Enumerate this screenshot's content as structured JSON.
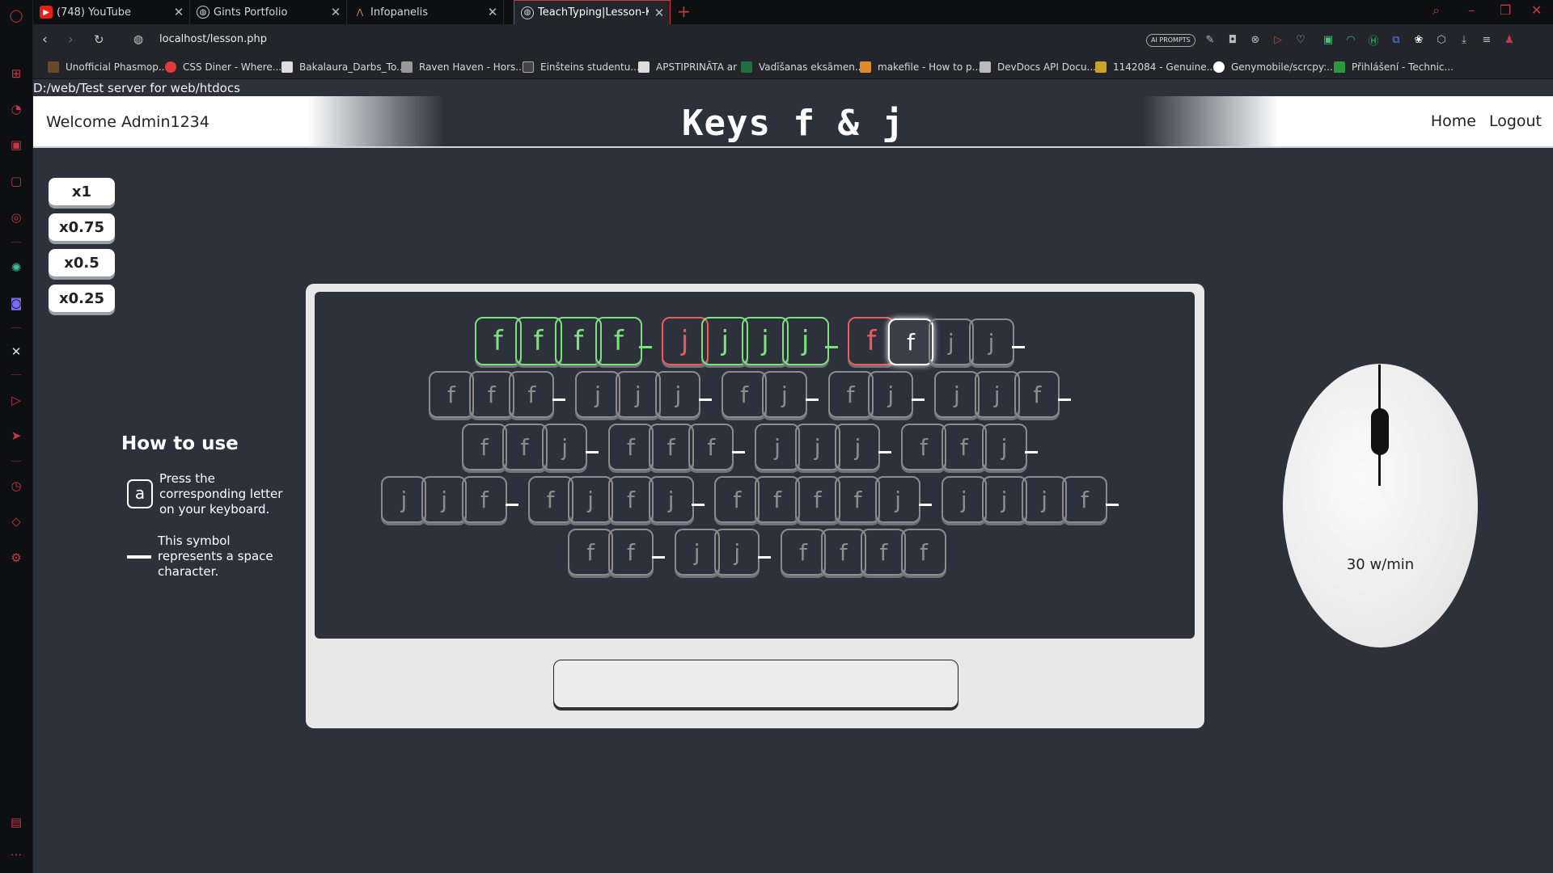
{
  "browser": {
    "tabs": [
      {
        "label": "(748) YouTube",
        "icon": "youtube-icon"
      },
      {
        "label": "Gints Portfolio",
        "icon": "globe-icon"
      },
      {
        "label": "Infopanelis",
        "icon": "infopanelis-icon"
      },
      {
        "label": "TeachTyping|Lesson-Keys f",
        "icon": "globe-icon"
      }
    ],
    "url": "localhost/lesson.php",
    "ai_prompts": "AI PROMPTS",
    "bookmarks": [
      "Unofficial Phasmop...",
      "CSS Diner - Where...",
      "Bakalaura_Darbs_To...",
      "Raven Haven - Hors...",
      "Einšteins studentu...",
      "APSTIPRINĀTA ar",
      "Vadīšanas eksāmen...",
      "makefile - How to p...",
      "DevDocs API Docu...",
      "1142084 - Genuine...",
      "Genymobile/scrcpy:...",
      "Přihlášení - Technic..."
    ]
  },
  "page": {
    "path": "D:/web/Test server for web/htdocs",
    "welcome": "Welcome Admin1234",
    "title": "Keys f & j",
    "nav": {
      "home": "Home",
      "logout": "Logout"
    },
    "speeds": [
      "x1",
      "x0.75",
      "x0.5",
      "x0.25"
    ],
    "how_to": {
      "heading": "How to use",
      "key_example": "a",
      "line1": [
        "Press the",
        "corresponding letter",
        "on your keyboard."
      ],
      "line2": [
        "This symbol",
        "represents a space",
        "character."
      ]
    },
    "wpm": "30 w/min",
    "input_value": ""
  },
  "lesson": {
    "rows": [
      "ffff jjjj ffjj ",
      "fff jjj fj fj jjf ",
      "ffj fff jjj ffj ",
      "jjf fjfj ffffj jjjf ",
      "ff jj ffff"
    ],
    "typed_count": 11,
    "errors": [
      5,
      10
    ]
  },
  "colors": {
    "correct": "#7ee07e",
    "wrong": "#ee5a5a",
    "pending": "#8c8c8c",
    "accent": "#c23a47"
  }
}
